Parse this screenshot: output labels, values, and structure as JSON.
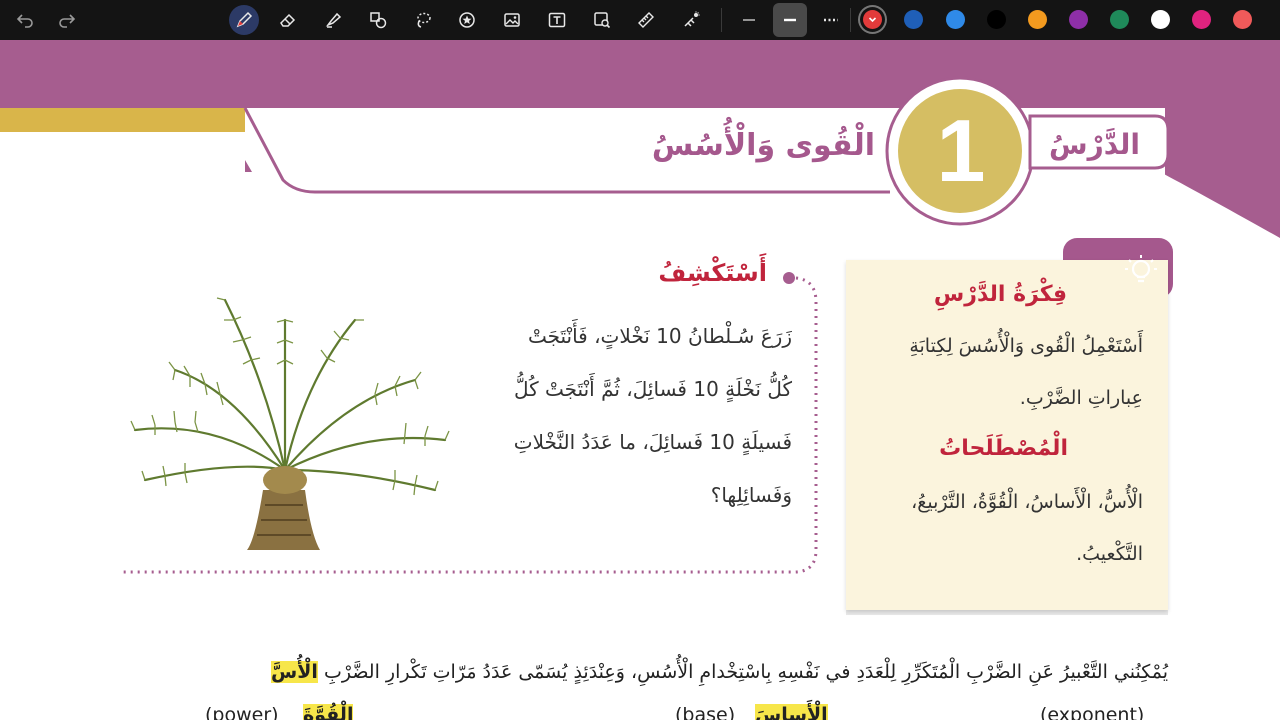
{
  "toolbar": {
    "tools": [
      {
        "name": "undo-icon"
      },
      {
        "name": "redo-icon"
      },
      {
        "name": "pen-icon"
      },
      {
        "name": "eraser-icon"
      },
      {
        "name": "highlighter-icon"
      },
      {
        "name": "shapes-icon"
      },
      {
        "name": "lasso-icon"
      },
      {
        "name": "sticker-icon"
      },
      {
        "name": "image-icon"
      },
      {
        "name": "text-icon"
      },
      {
        "name": "screenshot-icon"
      },
      {
        "name": "ruler-icon"
      },
      {
        "name": "laser-pointer-icon"
      },
      {
        "name": "thin-line-icon"
      },
      {
        "name": "medium-line-icon"
      },
      {
        "name": "dotted-line-icon"
      }
    ],
    "colors": [
      "#e23b3b",
      "#1f5fb8",
      "#2f8ae8",
      "#000000",
      "#f39a1f",
      "#8e2fa8",
      "#1f8a5a",
      "#ffffff",
      "#e0237f",
      "#f05a5a"
    ],
    "selected_color": "#e23b3b"
  },
  "lesson": {
    "label": "الدَّرْسُ",
    "number": "1",
    "title": "الْقُوى وَالْأُسُسُ"
  },
  "explore": {
    "heading": "أَسْتَكْشِفُ",
    "lines": [
      "زَرَعَ سُـلْطانُ 10 نَخْلاتٍ، فَأَنْتَجَتْ",
      "كُلُّ نَخْلَةٍ 10 فَسائِلَ، ثُمَّ أَنْتَجَتْ كُلُّ",
      "فَسيلَةٍ 10 فَسائِلَ، ما عَدَدُ النَّخْلاتِ",
      "وَفَسائِلِها؟"
    ]
  },
  "idea_card": {
    "idea_heading": "فِكْرَةُ الدَّرْسِ",
    "idea_lines": [
      "أَسْتَعْمِلُ الْقُوى وَالْأُسُسَ لِكِتابَةِ",
      "عِباراتِ الضَّرْبِ."
    ],
    "terms_heading": "الْمُصْطَلَحاتُ",
    "terms_lines": [
      "الْأُسُّ، الْأَساسُ، الْقُوَّةُ، التَّرْبيعُ،",
      "التَّكْعيبُ."
    ]
  },
  "paragraph": {
    "line1": "يُمْكِنُني التَّعْبيرُ عَنِ الضَّرْبِ الْمُتَكَرِّرِ لِلْعَدَدِ في نَفْسِهِ بِاسْتِخْدامِ الْأُسُسِ، وَعِنْدَئِذٍ يُسَمّى عَدَدُ مَرّاتِ تَكْرارِ الضَّرْبِ",
    "term1": "الْأُسَّ",
    "l2_power": "(power)",
    "l2_term": "الْقُوَّةَ",
    "l2_exponent": "(exponent)",
    "l2_base": "(base)",
    "l2_base_term": "الْأَساسَ"
  }
}
